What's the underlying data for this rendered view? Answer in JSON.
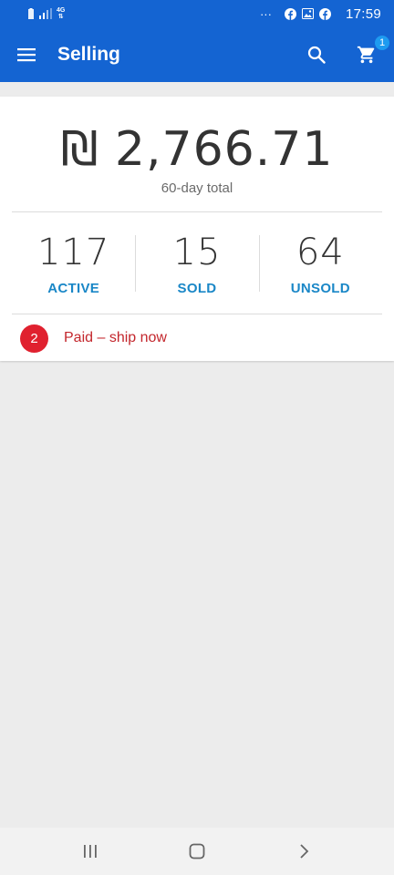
{
  "status_bar": {
    "network": "4G",
    "overflow_glyph": "···",
    "time": "17:59",
    "icons": [
      "battery-icon",
      "signal-icon",
      "facebook-icon",
      "gallery-icon",
      "facebook-icon"
    ]
  },
  "app_bar": {
    "title": "Selling",
    "cart_count": "1",
    "icons": [
      "menu-icon",
      "search-icon",
      "cart-icon"
    ]
  },
  "summary": {
    "amount": "₪ 2,766.71",
    "period_label": "60-day total"
  },
  "stats": [
    {
      "value": "117",
      "label": "ACTIVE"
    },
    {
      "value": "15",
      "label": "SOLD"
    },
    {
      "value": "64",
      "label": "UNSOLD"
    }
  ],
  "alert": {
    "count": "2",
    "text": "Paid – ship now"
  },
  "nav_bar": {
    "icons": [
      "recent-apps-icon",
      "home-icon",
      "back-icon"
    ]
  },
  "colors": {
    "primary": "#1464d2",
    "stat_label": "#1a87c7",
    "alert": "#e0212f",
    "background": "#ececec"
  }
}
